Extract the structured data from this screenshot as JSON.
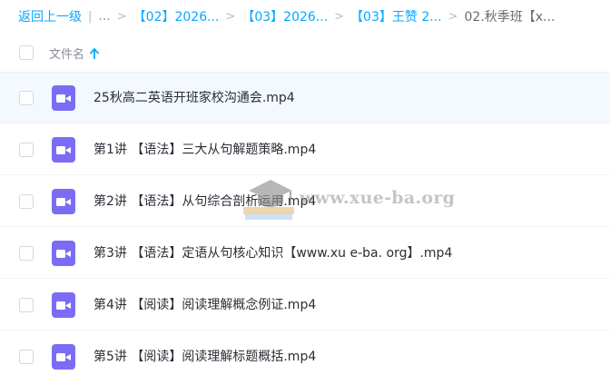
{
  "breadcrumb": {
    "back_label": "返回上一级",
    "ellipsis": "...",
    "items": [
      "【02】2026...",
      "【03】2026...",
      "【03】王赞 2..."
    ],
    "current": "02.秋季班【x..."
  },
  "header": {
    "column_name": "文件名",
    "sort_direction": "ascending",
    "sort_icon": "arrow-up-icon"
  },
  "files": [
    {
      "name": "25秋高二英语开班家校沟通会.mp4",
      "icon": "video-file-icon"
    },
    {
      "name": "第1讲 【语法】三大从句解题策略.mp4",
      "icon": "video-file-icon"
    },
    {
      "name": "第2讲 【语法】从句综合剖析运用.mp4",
      "icon": "video-file-icon"
    },
    {
      "name": "第3讲 【语法】定语从句核心知识【www.xu e-ba. org】.mp4",
      "icon": "video-file-icon"
    },
    {
      "name": "第4讲 【阅读】阅读理解概念例证.mp4",
      "icon": "video-file-icon"
    },
    {
      "name": "第5讲 【阅读】阅读理解标题概括.mp4",
      "icon": "video-file-icon"
    }
  ],
  "watermark": {
    "text": "www.xue-ba.org"
  },
  "colors": {
    "link": "#06a7ff",
    "video_icon": "#7b6cf6",
    "row_hover": "#f4f9ff"
  }
}
